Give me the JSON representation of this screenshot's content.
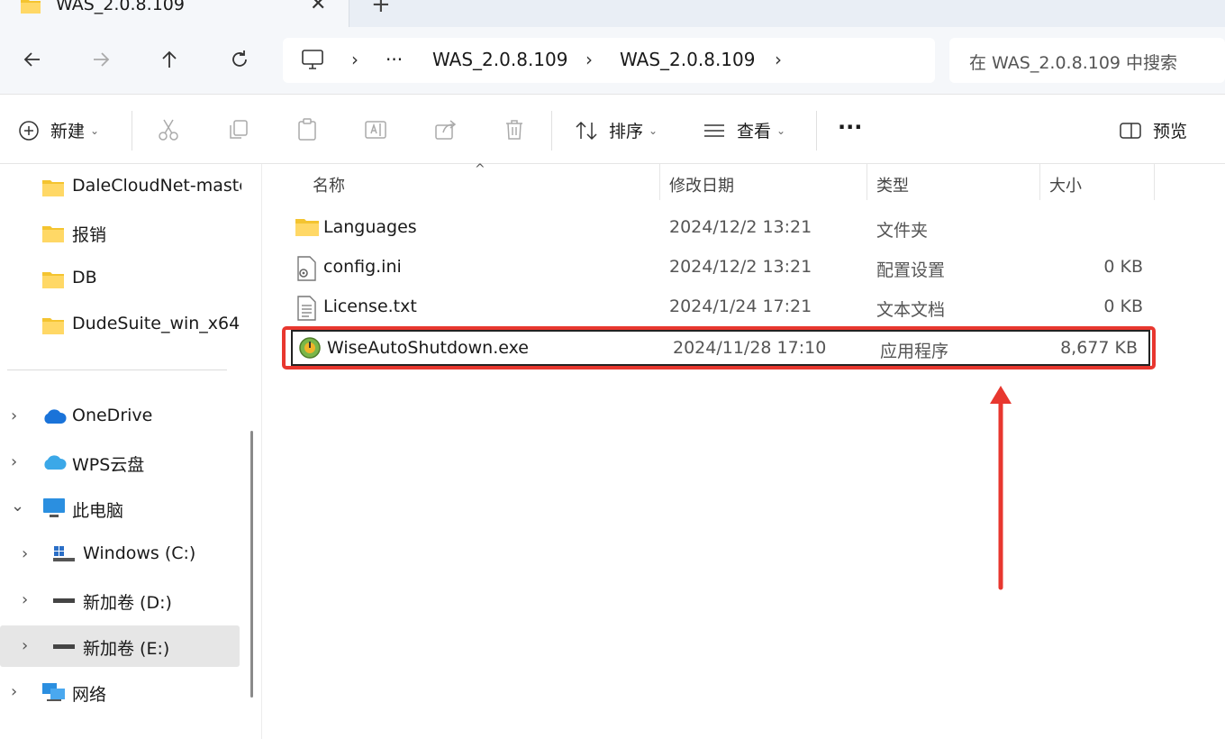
{
  "tab": {
    "title": "WAS_2.0.8.109",
    "close": "✕",
    "new_tab": "+"
  },
  "nav": {
    "back": "←",
    "forward": "→",
    "up": "↑",
    "refresh": "↻",
    "breadcrumb": {
      "more": "···",
      "sep": "›",
      "items": [
        "WAS_2.0.8.109",
        "WAS_2.0.8.109"
      ]
    },
    "search_placeholder": "在 WAS_2.0.8.109 中搜索"
  },
  "toolbar": {
    "new_label": "新建",
    "sort_label": "排序",
    "view_label": "查看",
    "more": "···",
    "preview_label": "预览",
    "caret": "⌄"
  },
  "sidebar": {
    "quick_access": [
      "DaleCloudNet-master",
      "报销",
      "DB",
      "DudeSuite_win_x64"
    ],
    "onedrive": "OneDrive",
    "wps": "WPS云盘",
    "this_pc": "此电脑",
    "drives": [
      "Windows (C:)",
      "新加卷 (D:)",
      "新加卷 (E:)"
    ],
    "network": "网络",
    "chev_right": "›",
    "chev_down": "⌄"
  },
  "columns": {
    "name": "名称",
    "modified": "修改日期",
    "type": "类型",
    "size": "大小",
    "sort_caret": "^"
  },
  "files": [
    {
      "name": "Languages",
      "modified": "2024/12/2 13:21",
      "type": "文件夹",
      "size": "",
      "icon": "folder-icon"
    },
    {
      "name": "config.ini",
      "modified": "2024/12/2 13:21",
      "type": "配置设置",
      "size": "0 KB",
      "icon": "config-file-icon"
    },
    {
      "name": "License.txt",
      "modified": "2024/1/24 17:21",
      "type": "文本文档",
      "size": "0 KB",
      "icon": "text-file-icon"
    },
    {
      "name": "WiseAutoShutdown.exe",
      "modified": "2024/11/28 17:10",
      "type": "应用程序",
      "size": "8,677 KB",
      "icon": "app-icon"
    }
  ],
  "colors": {
    "highlight": "#e8372f",
    "selection_border": "#222222",
    "folder": "#f4c430"
  }
}
